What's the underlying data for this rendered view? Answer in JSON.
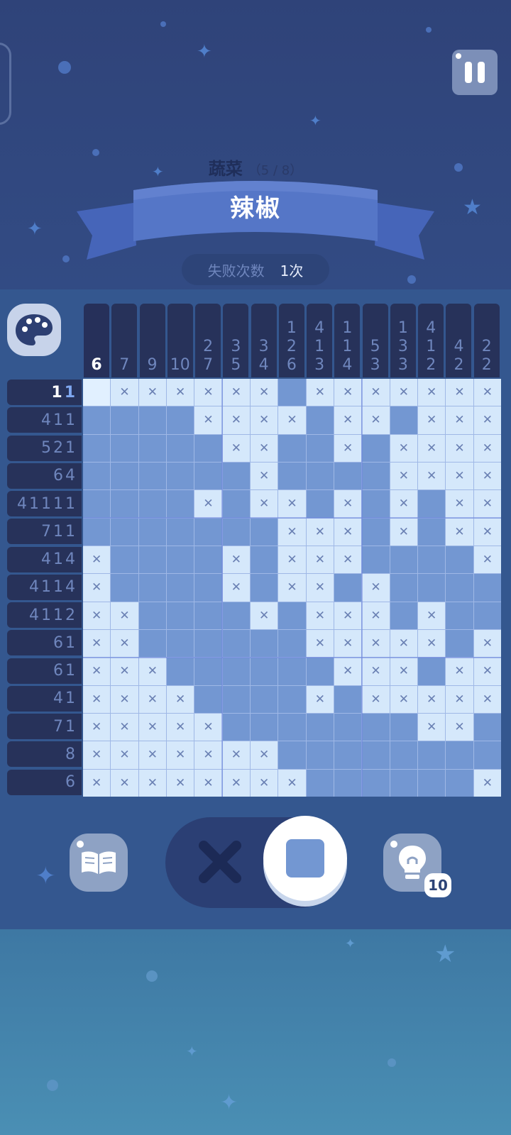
{
  "header": {
    "category": "蔬菜",
    "progress": "（5 / 8）",
    "puzzle_name": "辣椒"
  },
  "fail": {
    "label": "失败次数",
    "value": "1次"
  },
  "col_clues": [
    [
      "6"
    ],
    [
      "7"
    ],
    [
      "9"
    ],
    [
      "10"
    ],
    [
      "2",
      "7"
    ],
    [
      "3",
      "5"
    ],
    [
      "3",
      "4"
    ],
    [
      "1",
      "2",
      "6"
    ],
    [
      "4",
      "1",
      "3"
    ],
    [
      "1",
      "1",
      "4"
    ],
    [
      "5",
      "3"
    ],
    [
      "1",
      "3",
      "3"
    ],
    [
      "4",
      "1",
      "2"
    ],
    [
      "4",
      "2"
    ],
    [
      "2",
      "2"
    ]
  ],
  "row_clues": [
    [
      "1",
      "1"
    ],
    [
      "4",
      "1",
      "1"
    ],
    [
      "5",
      "2",
      "1"
    ],
    [
      "6",
      "4"
    ],
    [
      "4",
      "1",
      "1",
      "1",
      "1"
    ],
    [
      "7",
      "1",
      "1"
    ],
    [
      "4",
      "1",
      "4"
    ],
    [
      "4",
      "1",
      "1",
      "4"
    ],
    [
      "4",
      "1",
      "1",
      "2"
    ],
    [
      "6",
      "1"
    ],
    [
      "6",
      "1"
    ],
    [
      "4",
      "1"
    ],
    [
      "7",
      "1"
    ],
    [
      "8"
    ],
    [
      "6"
    ]
  ],
  "grid": [
    "SXXXXXXFXXXXXXX",
    "FFFFXXXXFXXFXXX",
    "FFFFFXXFFXFXXXX",
    "FFFFFFXFFFFXXXX",
    "FFFFXFXXFXFXFXX",
    "FFFFFFFXXXFXFXX",
    "XFFFFXFXXXFFFFX",
    "XFFFFXFXXFXFFFF",
    "XXFFFFXFXXXFXFF",
    "XXFFFFFFXXXXXFX",
    "XXXFFFFFFXXXFXX",
    "XXXXFFFFXFXXXXX",
    "XXXXXFFFFFFFXXF",
    "XXXXXXXFFFFFFFF",
    "XXXXXXXXFFFFFFX"
  ],
  "tools": {
    "hint_count": "10"
  },
  "colors": {
    "filled": "#7397d2",
    "crossed": "#d5e8fb",
    "accent": "#ffffff"
  },
  "icons": [
    "pause-icon",
    "palette-icon",
    "book-icon",
    "lightbulb-icon",
    "cross-icon",
    "square-icon"
  ]
}
